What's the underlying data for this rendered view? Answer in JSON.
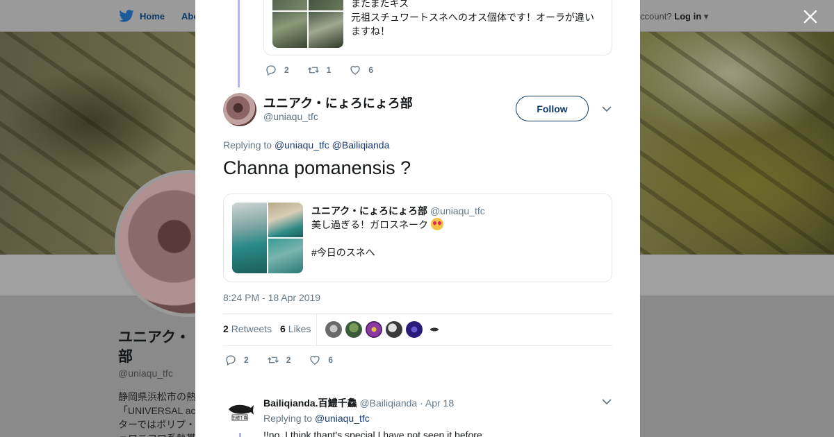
{
  "background_page": {
    "nav": {
      "home_label": "Home",
      "about_label": "Abo",
      "account_prompt": "ccount?",
      "login_label": "Log in"
    },
    "profile": {
      "name": "ユニアク・",
      "name_line2": "部",
      "handle": "@uniaqu_tfc",
      "bio_line1": "静岡県浜松市の熱",
      "bio_line2": "「UNIVERSAL ac",
      "bio_line3": "ターではポリプ・",
      "bio_line4": "ェロニコロ系執帯"
    }
  },
  "modal": {
    "previous_tweet": {
      "text_line1": "またまたキス",
      "text_line2": "元祖スチュワートスネへのオス個体です！オーラが違い",
      "text_line3": "ますね！",
      "reply_count": "2",
      "retweet_count": "1",
      "like_count": "6"
    },
    "main_tweet": {
      "author_name": "ユニアク・にょろにょろ部",
      "author_handle": "@uniaqu_tfc",
      "follow_label": "Follow",
      "replying_prefix": "Replying to",
      "replying_to_1": "@uniaqu_tfc",
      "replying_to_2": "@Bailiqianda",
      "text": "Channa pomanensis ?",
      "quoted": {
        "author_name": "ユニアク・にょろにょろ部",
        "author_handle": "@uniaqu_tfc",
        "text": "美し過ぎる！ガロスネーク",
        "hashtag": "#今日のスネへ"
      },
      "timestamp": "8:24 PM - 18 Apr 2019",
      "retweets_count": "2",
      "retweets_label": "Retweets",
      "likes_count": "6",
      "likes_label": "Likes",
      "reply_count": "2",
      "retweet_count": "2",
      "like_count": "6"
    },
    "reply_tweet": {
      "author_name": "Bailiqianda.百鱧千鱻",
      "author_handle": "@Bailiqianda",
      "date": "· Apr 18",
      "replying_prefix": "Replying to",
      "replying_to": "@uniaqu_tfc",
      "text": "!!no. I think thant's special I have not seen it before",
      "logo_text": "百鱧千鱻"
    }
  },
  "colors": {
    "link": "#1b3b6f",
    "muted": "#657786",
    "thread_line": "#b3b6e8",
    "follow": "#0d3a66"
  },
  "icons": [
    "twitter-bird-icon",
    "close-icon",
    "reply-icon",
    "retweet-icon",
    "like-icon",
    "chevron-down-icon"
  ]
}
